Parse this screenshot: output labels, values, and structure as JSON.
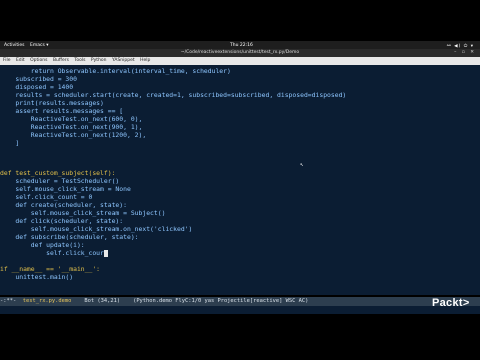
{
  "top_bar": {
    "activities": "Activities",
    "app_menu": "Emacs ▾",
    "clock": "Thu 22:16",
    "tray": "⚯ ◀) ⏻ ▾"
  },
  "window": {
    "title": "~/Code/reactiveextensions/unittest/test_rx.py/Demo",
    "controls": "– ▫ ✕"
  },
  "menu": [
    "File",
    "Edit",
    "Options",
    "Buffers",
    "Tools",
    "Python",
    "YASnippet",
    "Help"
  ],
  "code_lines": [
    "        return Observable.interval(interval_time, scheduler)",
    "    subscribed = 300",
    "    disposed = 1400",
    "    results = scheduler.start(create, created=1, subscribed=subscribed, disposed=disposed)",
    "    print(results.messages)",
    "    assert results.messages == [",
    "        ReactiveTest.on_next(600, 0),",
    "        ReactiveTest.on_next(900, 1),",
    "        ReactiveTest.on_next(1200, 2),",
    "    ]",
    "",
    "",
    "def test_custom_subject(self):",
    "    scheduler = TestScheduler()",
    "    self.mouse_click_stream = None",
    "    self.click_count = 0",
    "    def create(scheduler, state):",
    "        self.mouse_click_stream = Subject()",
    "    def click(scheduler, state):",
    "        self.mouse_click_stream.on_next('clicked')",
    "    def subscribe(scheduler, state):",
    "        def update(i):",
    "            self.click_cour",
    "",
    "if __name__ == '__main__':",
    "    unittest.main()"
  ],
  "modeline": {
    "prefix": "-:**-  ",
    "filename": "test_rx.py.demo",
    "status": "    Bot (34,21)    (Python.demo FlyC:1/0 yas Projectile[reactive] WSC AC)"
  },
  "brand": "Packt>"
}
